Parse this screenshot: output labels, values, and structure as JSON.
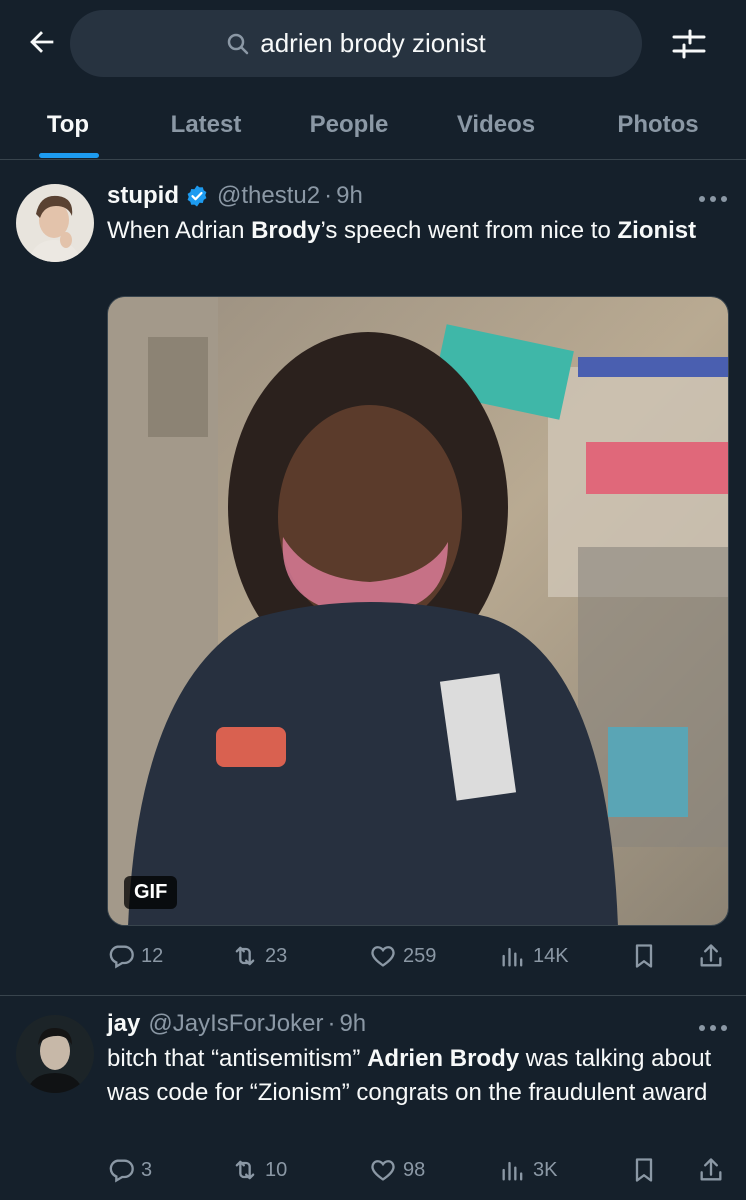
{
  "search": {
    "query": "adrien brody zionist",
    "back_icon": "arrow-left-icon",
    "search_icon": "search-icon",
    "filter_icon": "sliders-icon"
  },
  "tabs": [
    {
      "label": "Top",
      "active": true
    },
    {
      "label": "Latest",
      "active": false
    },
    {
      "label": "People",
      "active": false
    },
    {
      "label": "Videos",
      "active": false
    },
    {
      "label": "Photos",
      "active": false
    }
  ],
  "tweets": [
    {
      "name": "stupid",
      "verified": true,
      "handle": "@thestu2",
      "time_sep": "·",
      "time": "9h",
      "text_parts": [
        {
          "t": "When Adrian ",
          "b": false
        },
        {
          "t": "Brody",
          "b": true
        },
        {
          "t": "’s speech went from nice to ",
          "b": false
        },
        {
          "t": "Zionist",
          "b": true
        }
      ],
      "media_badge": "GIF",
      "stats": {
        "replies": "12",
        "reposts": "23",
        "likes": "259",
        "views": "14K"
      }
    },
    {
      "name": "jay",
      "verified": false,
      "handle": "@JayIsForJoker",
      "time_sep": "·",
      "time": "9h",
      "text_parts": [
        {
          "t": "bitch that “antisemitism” ",
          "b": false
        },
        {
          "t": "Adrien Brody",
          "b": true
        },
        {
          "t": " was talking about was code for “Zionism” congrats on the fraudulent award",
          "b": false
        }
      ],
      "stats": {
        "replies": "3",
        "reposts": "10",
        "likes": "98",
        "views": "3K"
      }
    }
  ],
  "colors": {
    "background": "#15202b",
    "accent": "#1d9bf0",
    "muted": "#8b98a5",
    "divider": "#38444d"
  }
}
